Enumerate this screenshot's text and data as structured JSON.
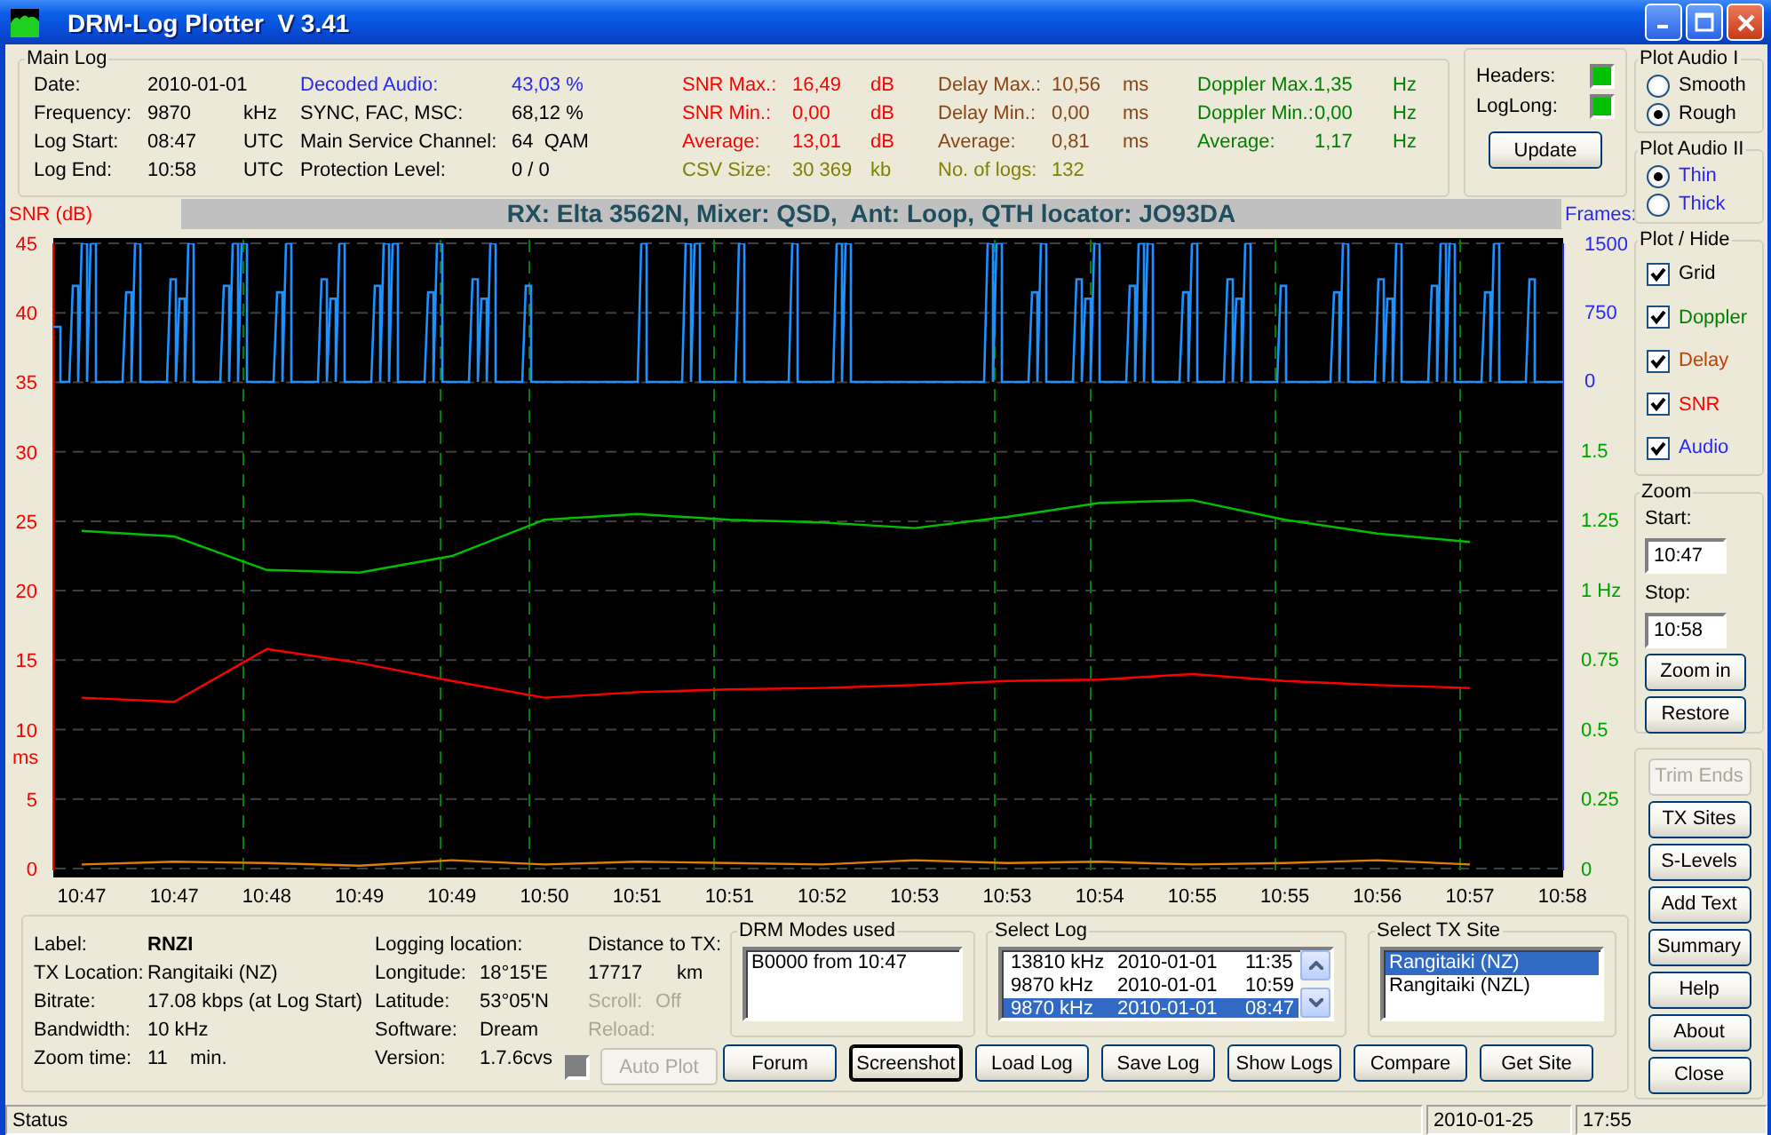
{
  "window": {
    "title": "DRM-Log Plotter  V 3.41"
  },
  "main_log": {
    "title": "Main Log",
    "columns": [
      {
        "rows": [
          {
            "label": "Date:",
            "value": "2010-01-01",
            "color": "#000000"
          },
          {
            "label": "Frequency:",
            "value": "9870",
            "unit": "kHz",
            "color": "#000000"
          },
          {
            "label": "Log Start:",
            "value": "08:47",
            "unit": "UTC",
            "color": "#000000"
          },
          {
            "label": "Log End:",
            "value": "10:58",
            "unit": "UTC",
            "color": "#000000"
          }
        ]
      },
      {
        "rows": [
          {
            "label": "Decoded Audio:",
            "value": "43,03 %",
            "color": "#2828f0"
          },
          {
            "label": "SYNC, FAC, MSC:",
            "value": "68,12 %",
            "color": "#000000"
          },
          {
            "label": "Main Service Channel:",
            "value": "64  QAM",
            "color": "#000000"
          },
          {
            "label": "Protection Level:",
            "value": "0 / 0",
            "color": "#000000"
          }
        ]
      },
      {
        "rows": [
          {
            "label": "SNR Max.:",
            "value": "16,49",
            "unit": "dB",
            "color": "#ff0000"
          },
          {
            "label": "SNR Min.:",
            "value": "0,00",
            "unit": "dB",
            "color": "#ff0000"
          },
          {
            "label": "Average:",
            "value": "13,01",
            "unit": "dB",
            "color": "#ff0000"
          },
          {
            "label": "CSV Size:",
            "value": "30 369",
            "unit": "kb",
            "color": "#808000"
          }
        ]
      },
      {
        "rows": [
          {
            "label": "Delay Max.:",
            "value": "10,56",
            "unit": "ms",
            "color": "#8b4513"
          },
          {
            "label": "Delay Min.:",
            "value": "0,00",
            "unit": "ms",
            "color": "#8b4513"
          },
          {
            "label": "Average:",
            "value": "0,81",
            "unit": "ms",
            "color": "#8b4513"
          },
          {
            "label": "No. of logs:",
            "value": "132",
            "color": "#808000"
          }
        ]
      },
      {
        "rows": [
          {
            "label": "Doppler Max.:",
            "value": "1,35",
            "unit": "Hz",
            "color": "#008000"
          },
          {
            "label": "Doppler Min.:",
            "value": "0,00",
            "unit": "Hz",
            "color": "#008000"
          },
          {
            "label": "Average:",
            "value": "1,17",
            "unit": "Hz",
            "color": "#008000"
          }
        ]
      }
    ]
  },
  "indicators": {
    "items": [
      {
        "label": "Headers:",
        "on": true
      },
      {
        "label": "LogLong:",
        "on": true
      }
    ],
    "button": "Update"
  },
  "chart": {
    "left_label": "SNR (dB)",
    "banner": "RX: Elta 3562N, Mixer: QSD,  Ant: Loop, QTH locator: JO93DA",
    "right_label": "Frames:",
    "ms_label": "ms",
    "frames_ticks": [
      "1500",
      "750",
      "0"
    ],
    "chart_data": {
      "type": "line",
      "grid": true,
      "y2lim": [
        0,
        2.24
      ],
      "categories": [
        "10:47",
        "10:47",
        "10:48",
        "10:49",
        "10:49",
        "10:50",
        "10:51",
        "10:51",
        "10:52",
        "10:53",
        "10:53",
        "10:54",
        "10:55",
        "10:55",
        "10:56",
        "10:57",
        "10:58"
      ],
      "ylim": [
        0,
        45
      ],
      "yticks": [
        0,
        5,
        10,
        15,
        20,
        25,
        30,
        35,
        40,
        45
      ],
      "y2ticks": [
        1.5,
        1.25,
        {
          "value": 1,
          "label": "1 Hz"
        },
        0.75,
        0.5,
        0.25,
        0
      ],
      "series": [
        {
          "color": "#ff0000",
          "values": [
            12.3,
            12.0,
            15.8,
            14.8,
            13.5,
            12.3,
            12.7,
            12.9,
            13.0,
            13.2,
            13.5,
            13.6,
            14.0,
            13.5,
            13.2,
            13.0,
            null
          ]
        },
        {
          "color": "#00c000",
          "axis": "y2",
          "values": [
            1.21,
            1.19,
            1.07,
            1.06,
            1.12,
            1.25,
            1.27,
            1.25,
            1.24,
            1.22,
            1.26,
            1.31,
            1.32,
            1.25,
            1.2,
            1.17,
            null
          ]
        },
        {
          "color": "#e08000",
          "values": [
            0.3,
            0.5,
            0.4,
            0.2,
            0.6,
            0.3,
            0.5,
            0.4,
            0.3,
            0.6,
            0.4,
            0.5,
            0.3,
            0.4,
            0.6,
            0.3,
            null
          ]
        }
      ]
    }
  },
  "station": {
    "rows": [
      {
        "label": "Label:",
        "value": "RNZI",
        "kind": "title"
      },
      {
        "label": "TX Location:",
        "value": "Rangitaiki (NZ)",
        "kind": "plain"
      },
      {
        "label": "Bitrate:",
        "value": "17.08 kbps (at Log Start)",
        "kind": "plain"
      },
      {
        "label": "Bandwidth:",
        "value": "10 kHz",
        "kind": "plain"
      },
      {
        "label": "Zoom time:",
        "value": "11",
        "unit": "min.",
        "kind": "plain"
      }
    ]
  },
  "location": {
    "heading": "Logging location:",
    "rows": [
      {
        "label": "Longitude:",
        "value": "18°15'E"
      },
      {
        "label": "Latitude:",
        "value": "53°05'N"
      },
      {
        "label": "Software:",
        "value": "Dream"
      },
      {
        "label": "Version:",
        "value": "1.7.6cvs"
      }
    ]
  },
  "distance": {
    "heading": "Distance to TX:",
    "value": "17717",
    "unit": "km",
    "rows": [
      {
        "label": "Scroll:",
        "value": "Off",
        "disabled": true
      },
      {
        "label": "Reload:",
        "disabled": true
      }
    ],
    "auto_plot": {
      "on": false,
      "label": "Auto Plot",
      "disabled": true
    }
  },
  "drm_modes": {
    "title": "DRM Modes used",
    "items": [
      "B0000 from 10:47"
    ]
  },
  "select_log": {
    "title": "Select Log",
    "items": [
      {
        "freq": "13810 kHz",
        "date": "2010-01-01",
        "time": "11:35",
        "selected": false
      },
      {
        "freq": "9870 kHz",
        "date": "2010-01-01",
        "time": "10:59",
        "selected": false
      },
      {
        "freq": "9870 kHz",
        "date": "2010-01-01",
        "time": "08:47",
        "selected": true
      }
    ]
  },
  "select_tx": {
    "title": "Select TX Site",
    "items": [
      {
        "label": "Rangitaiki (NZ)",
        "selected": true
      },
      {
        "label": "Rangitaiki (NZL)",
        "selected": false
      }
    ]
  },
  "bottom_buttons": [
    {
      "label": "Forum",
      "focused": false
    },
    {
      "label": "Screenshot",
      "focused": true
    },
    {
      "label": "Load Log",
      "focused": false
    },
    {
      "label": "Save Log",
      "focused": false
    },
    {
      "label": "Show Logs",
      "focused": false
    },
    {
      "label": "Compare",
      "focused": false
    },
    {
      "label": "Get Site",
      "focused": false
    }
  ],
  "plot_audio_1": {
    "title": "Plot Audio I",
    "options": [
      {
        "label": "Smooth",
        "selected": false,
        "color": "#000000"
      },
      {
        "label": "Rough",
        "selected": true,
        "color": "#000000"
      }
    ]
  },
  "plot_audio_2": {
    "title": "Plot Audio II",
    "options": [
      {
        "label": "Thin",
        "selected": true,
        "color": "#2828f0"
      },
      {
        "label": "Thick",
        "selected": false,
        "color": "#2828f0"
      }
    ]
  },
  "plot_hide": {
    "title": "Plot / Hide",
    "items": [
      {
        "label": "Grid",
        "checked": true,
        "color": "#000000"
      },
      {
        "label": "Doppler",
        "checked": true,
        "color": "#008000"
      },
      {
        "label": "Delay",
        "checked": true,
        "color": "#c04000"
      },
      {
        "label": "SNR",
        "checked": true,
        "color": "#ff0000"
      },
      {
        "label": "Audio",
        "checked": true,
        "color": "#2828f0"
      }
    ]
  },
  "zoom": {
    "title": "Zoom",
    "start_label": "Start:",
    "start": "10:47",
    "stop_label": "Stop:",
    "stop": "10:58",
    "buttons": [
      "Zoom in",
      "Restore"
    ]
  },
  "side_buttons": [
    {
      "label": "Trim Ends",
      "disabled": true
    },
    {
      "label": "TX Sites",
      "disabled": false
    },
    {
      "label": "S-Levels",
      "disabled": false
    },
    {
      "label": "Add Text",
      "disabled": false
    },
    {
      "label": "Summary",
      "disabled": false
    },
    {
      "label": "Help",
      "disabled": false
    },
    {
      "label": "About",
      "disabled": false
    },
    {
      "label": "Close",
      "disabled": false
    }
  ],
  "status_bar": [
    "Status",
    "2010-01-25",
    "17:55"
  ]
}
